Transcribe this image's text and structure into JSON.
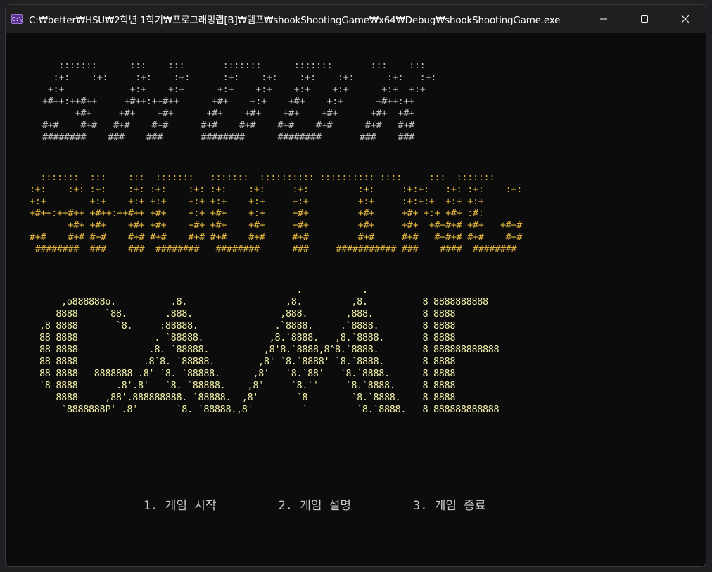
{
  "window": {
    "title": "C:₩better₩HSU₩2학년 1학기₩프로그래밍랩[B]₩템프₩shookShootingGame₩x64₩Debug₩shookShootingGame.exe",
    "icon": "console-app-icon",
    "icon_text": "C:\\"
  },
  "controls": {
    "minimize_icon": "minimize-icon",
    "maximize_icon": "maximize-icon",
    "close_icon": "close-icon"
  },
  "art": {
    "shook": "   :::::::      :::    :::       :::::::      :::::::       :::    :::\n  :+:    :+:     :+:    :+:      :+:    :+:    :+:    :+:      :+:   :+:\n +:+            +:+    +:+      +:+    +:+    +:+    +:+      +:+  +:+\n+#++:++#++     +#++:++#++      +#+    +:+    +#+    +:+      +#++:++\n      +#+     +#+    +#+      +#+    +#+    +#+    +#+      +#+  +#+\n#+#    #+#   #+#    #+#      #+#    #+#    #+#    #+#      #+#   #+#\n########    ###    ###       ########      ########       ###    ###",
    "shooting": "  :::::::  :::    :::  :::::::   :::::::  :::::::::: :::::::::: ::::     :::  :::::::\n:+:    :+: :+:    :+: :+:    :+: :+:    :+:     :+:         :+:     :+:+:   :+: :+:    :+:\n+:+        +:+    +:+ +:+    +:+ +:+    +:+     +:+         +:+     :+:+:+  +:+ +:+\n+#++:++#++ +#++:++#++ +#+    +:+ +#+    +:+     +#+         +#+     +#+ +:+ +#+ :#:\n       +#+ +#+    +#+ +#+    +#+ +#+    +#+     +#+         +#+     +#+  +#+#+# +#+   +#+#\n#+#    #+# #+#    #+# #+#    #+# #+#    #+#     #+#         #+#     #+#   #+#+# #+#    #+#\n ########  ###    ###  ########   ########      ###     ########### ###    ####  ########",
    "game": "                                               .           .\n    ,o888888o.          .8.                  ,8.         ,8.          8 8888888888\n   8888     `88.       .888.                ,888.       ,888.         8 8888\n,8 8888       `8.     :88888.              .`8888.     .`8888.        8 8888\n88 8888              . `88888.            ,8.`8888.   ,8.`8888.       8 8888\n88 8888             .8. `88888.          ,8'8.`8888,8^8.`8888.        8 888888888888\n88 8888            .8`8. `88888.        ,8' `8.`8888' `8.`8888.       8 8888\n88 8888   8888888 .8' `8. `88888.      ,8'   `8.`88'   `8.`8888.      8 8888\n`8 8888       .8'.8'   `8. `88888.    ,8'     `8.`'     `8.`8888.     8 8888\n   8888     ,88'.888888888. `88888.  ,8'       `8        `8.`8888.    8 8888\n    `8888888P' .8'       `8. `88888.,8'         `         `8.`8888.   8 888888888888"
  },
  "menu": {
    "start": "1. 게임 시작",
    "help": "2. 게임 설명",
    "exit": "3. 게임 종료"
  }
}
